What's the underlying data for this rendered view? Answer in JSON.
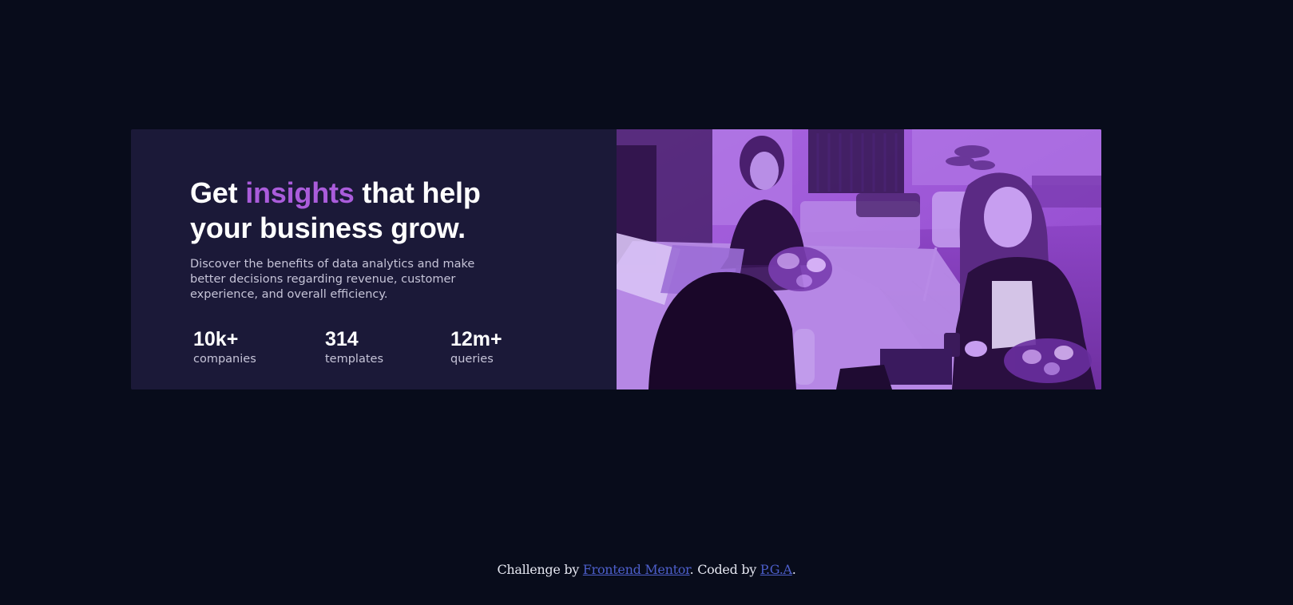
{
  "hero": {
    "headline_before": "Get ",
    "headline_accent": "insights",
    "headline_after": " that help your business grow.",
    "description": "Discover the benefits of data analytics and make better decisions regarding revenue, customer experience, and overall efficiency.",
    "accent_color": "#aa5cdb"
  },
  "stats": [
    {
      "value": "10k+",
      "label": "companies"
    },
    {
      "value": "314",
      "label": "templates"
    },
    {
      "value": "12m+",
      "label": "queries"
    }
  ],
  "footer": {
    "prefix": "Challenge by ",
    "link1": "Frontend Mentor",
    "middle": ". Coded by ",
    "link2": "P.G.A",
    "suffix": "."
  },
  "colors": {
    "page_background": "#080c1b",
    "card_background": "#1b1938",
    "image_tint": "#aa5cdb",
    "link": "#4d5fcb"
  }
}
